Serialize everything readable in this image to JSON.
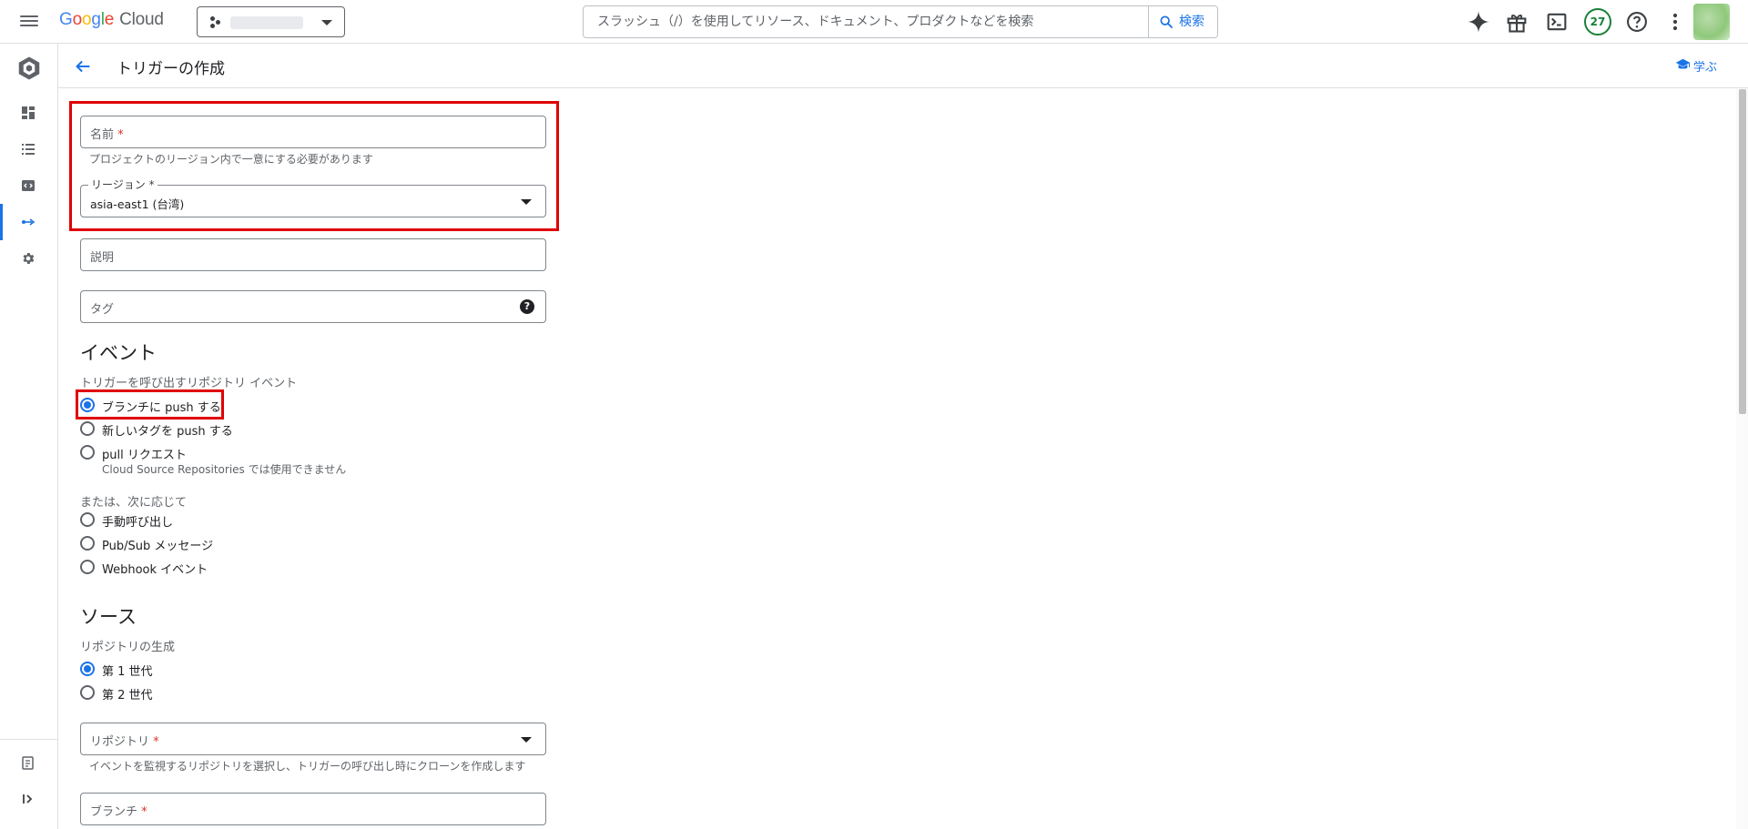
{
  "topbar": {
    "logo_parts": [
      "G",
      "o",
      "o",
      "g",
      "l",
      "e"
    ],
    "logo_cloud": "Cloud",
    "search_placeholder": "スラッシュ（/）を使用してリソース、ドキュメント、プロダクトなどを検索",
    "search_button": "検索",
    "notification_count": "27"
  },
  "header": {
    "title": "トリガーの作成",
    "learn": "学ぶ"
  },
  "form": {
    "name": {
      "label": "名前",
      "required_mark": "*",
      "hint": "プロジェクトのリージョン内で一意にする必要があります"
    },
    "region": {
      "label": "リージョン",
      "required_mark": "*",
      "value": "asia-east1 (台湾)"
    },
    "description": {
      "label": "説明"
    },
    "tags": {
      "label": "タグ",
      "help": "?"
    },
    "event": {
      "title": "イベント",
      "subtitle": "トリガーを呼び出すリポジトリ イベント",
      "options": [
        {
          "label": "ブランチに push する",
          "checked": true
        },
        {
          "label": "新しいタグを push する",
          "checked": false
        },
        {
          "label": "pull リクエスト",
          "sub": "Cloud Source Repositories では使用できません",
          "checked": false
        }
      ],
      "or_label": "または、次に応じて",
      "other_options": [
        {
          "label": "手動呼び出し",
          "checked": false
        },
        {
          "label": "Pub/Sub メッセージ",
          "checked": false
        },
        {
          "label": "Webhook イベント",
          "checked": false
        }
      ]
    },
    "source": {
      "title": "ソース",
      "subtitle": "リポジトリの生成",
      "options": [
        {
          "label": "第 1 世代",
          "checked": true
        },
        {
          "label": "第 2 世代",
          "checked": false
        }
      ],
      "repository": {
        "label": "リポジトリ",
        "required_mark": "*",
        "hint": "イベントを監視するリポジトリを選択し、トリガーの呼び出し時にクローンを作成します"
      },
      "branch": {
        "label": "ブランチ",
        "required_mark": "*"
      }
    }
  },
  "colors": {
    "accent": "#1a73e8",
    "highlight": "#e00000"
  }
}
